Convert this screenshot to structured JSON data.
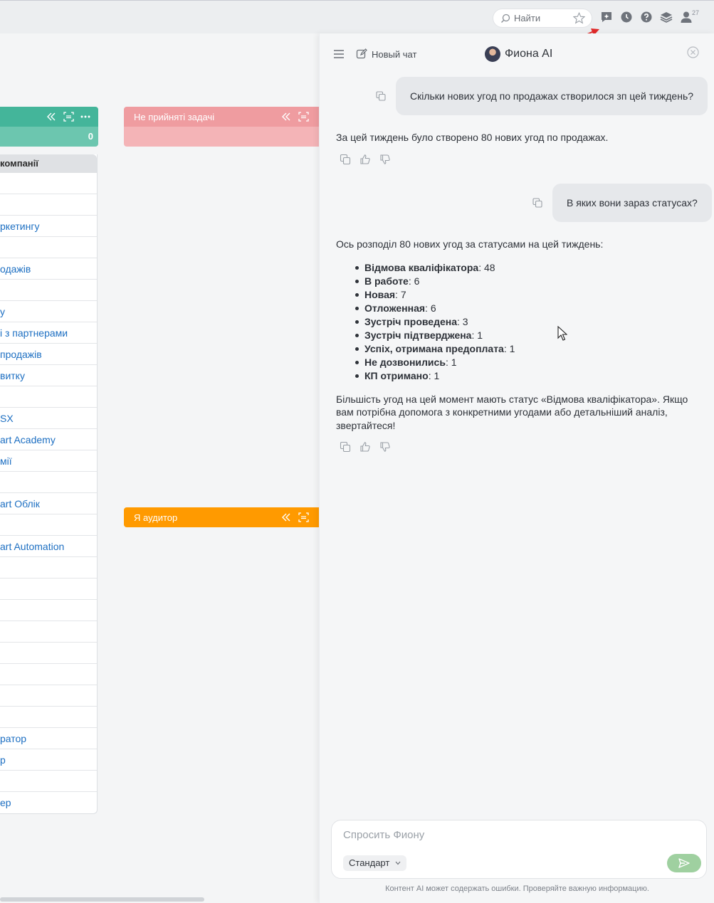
{
  "topbar": {
    "search_placeholder": "Найти",
    "notification_count": "27",
    "icons": [
      "search-icon",
      "star-icon",
      "ai-chat-icon",
      "clock-icon",
      "help-icon",
      "layers-icon",
      "user-icon"
    ]
  },
  "board": {
    "columns": [
      {
        "label": "",
        "count": "0",
        "color": "#44b59a"
      },
      {
        "label": "Не прийняті задачі",
        "color": "#ef9ca0"
      },
      {
        "label": "Я аудитор",
        "color": "#ff9a00"
      }
    ],
    "table_header": "компанії",
    "rows": [
      "",
      "",
      "ркетингу",
      "",
      "одажів",
      "",
      "у",
      "і з партнерами",
      " продажів",
      "витку",
      "",
      "SX",
      "art Academy",
      "мії",
      "",
      "art Облік",
      "",
      "art Automation",
      "",
      "",
      "",
      "",
      "",
      "",
      "",
      "",
      "ратор",
      "р",
      "",
      "ер"
    ]
  },
  "chat": {
    "new_chat_label": "Новый чат",
    "assistant_name": "Фиона AI",
    "messages": [
      {
        "role": "user",
        "text": "Скільки нових угод по продажах створилося зп цей тиждень?"
      },
      {
        "role": "assistant",
        "text": "За цей тиждень було створено 80 нових угод по продажах."
      },
      {
        "role": "user",
        "text": "В яких вони зараз статусах?"
      },
      {
        "role": "assistant",
        "intro": "Ось розподіл 80 нових угод за статусами на цей тиждень:",
        "items": [
          {
            "label": "Відмова кваліфікатора",
            "value": ": 48"
          },
          {
            "label": "В работе",
            "value": ": 6"
          },
          {
            "label": "Новая",
            "value": ": 7"
          },
          {
            "label": "Отложенная",
            "value": ": 6"
          },
          {
            "label": "Зустріч проведена",
            "value": ": 3"
          },
          {
            "label": "Зустріч підтверджена",
            "value": ": 1"
          },
          {
            "label": "Успіх, отримана предоплата",
            "value": ": 1"
          },
          {
            "label": "Не дозвонились",
            "value": ": 1"
          },
          {
            "label": "КП отримано",
            "value": ": 1"
          }
        ],
        "outro": "Більшість угод на цей момент мають статус «Відмова кваліфікатора». Якщо вам потрібна допомога з конкретними угодами або детальніший аналіз, звертайтеся!"
      }
    ],
    "input_placeholder": "Спросить Фиону",
    "mode_label": "Стандарт",
    "disclaimer": "Контент AI может содержать ошибки. Проверяйте важную информацию.",
    "accent_color": "#9fd0a0"
  }
}
